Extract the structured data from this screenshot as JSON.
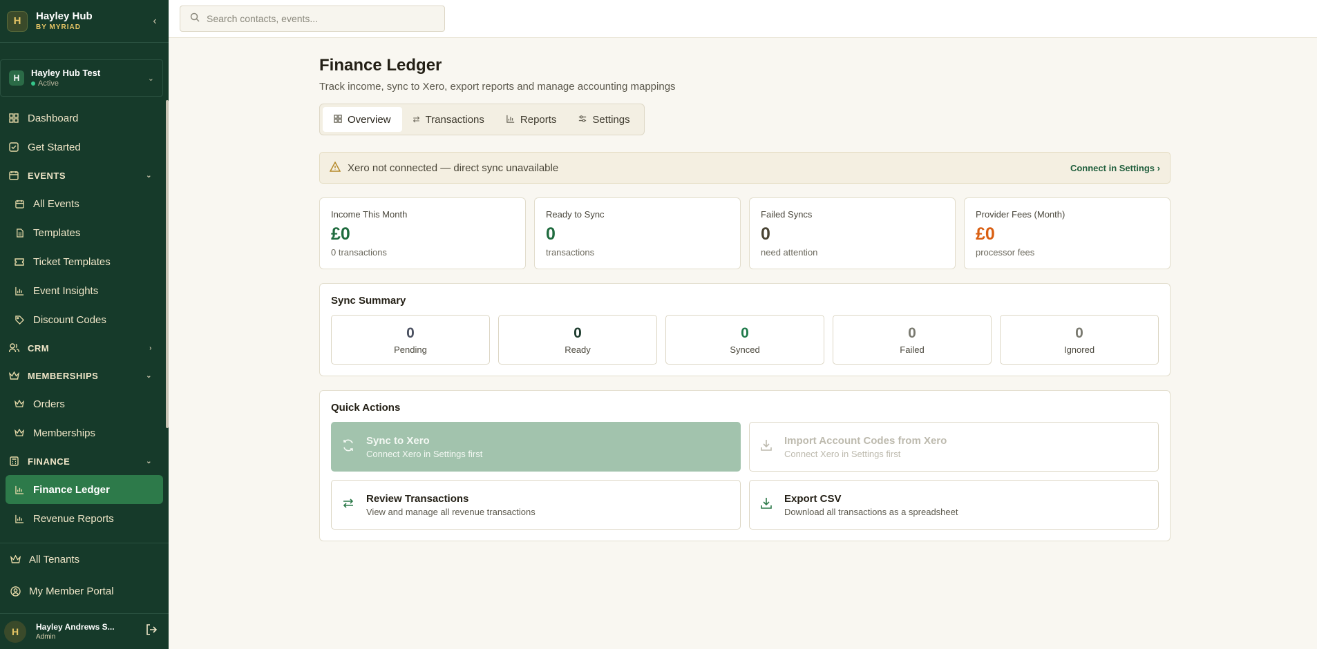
{
  "brand": {
    "name": "Hayley Hub",
    "sub": "BY MYRIAD",
    "logo": "H"
  },
  "tenant": {
    "initial": "H",
    "name": "Hayley Hub Test",
    "status": "Active"
  },
  "sidebar": {
    "dashboard": "Dashboard",
    "get_started": "Get Started",
    "events_section": "EVENTS",
    "all_events": "All Events",
    "templates": "Templates",
    "ticket_templates": "Ticket Templates",
    "event_insights": "Event Insights",
    "discount_codes": "Discount Codes",
    "crm_section": "CRM",
    "memberships_section": "MEMBERSHIPS",
    "orders": "Orders",
    "memberships": "Memberships",
    "finance_section": "FINANCE",
    "finance_ledger": "Finance Ledger",
    "revenue_reports": "Revenue Reports",
    "all_tenants": "All Tenants",
    "member_portal": "My Member Portal"
  },
  "user": {
    "initial": "H",
    "name": "Hayley Andrews S...",
    "role": "Admin"
  },
  "search": {
    "placeholder": "Search contacts, events..."
  },
  "page": {
    "title": "Finance Ledger",
    "subtitle": "Track income, sync to Xero, export reports and manage accounting mappings"
  },
  "tabs": {
    "overview": "Overview",
    "transactions": "Transactions",
    "reports": "Reports",
    "settings": "Settings"
  },
  "alert": {
    "text": "Xero not connected — direct sync unavailable",
    "link": "Connect in Settings"
  },
  "stats": [
    {
      "label": "Income This Month",
      "value": "£0",
      "sub": "0 transactions",
      "color": "#1f6b3e"
    },
    {
      "label": "Ready to Sync",
      "value": "0",
      "sub": "transactions",
      "color": "#1f6b3e"
    },
    {
      "label": "Failed Syncs",
      "value": "0",
      "sub": "need attention",
      "color": "#4a4535"
    },
    {
      "label": "Provider Fees (Month)",
      "value": "£0",
      "sub": "processor fees",
      "color": "#d95f12"
    }
  ],
  "sync_summary": {
    "title": "Sync Summary",
    "items": [
      {
        "value": "0",
        "label": "Pending",
        "color": "#4a5060"
      },
      {
        "value": "0",
        "label": "Ready",
        "color": "#1c3a2c"
      },
      {
        "value": "0",
        "label": "Synced",
        "color": "#1f7a4a"
      },
      {
        "value": "0",
        "label": "Failed",
        "color": "#7a7a70"
      },
      {
        "value": "0",
        "label": "Ignored",
        "color": "#7a7a70"
      }
    ]
  },
  "quick_actions": {
    "title": "Quick Actions",
    "sync": {
      "title": "Sync to Xero",
      "sub": "Connect Xero in Settings first"
    },
    "import": {
      "title": "Import Account Codes from Xero",
      "sub": "Connect Xero in Settings first"
    },
    "review": {
      "title": "Review Transactions",
      "sub": "View and manage all revenue transactions"
    },
    "export": {
      "title": "Export CSV",
      "sub": "Download all transactions as a spreadsheet"
    }
  }
}
